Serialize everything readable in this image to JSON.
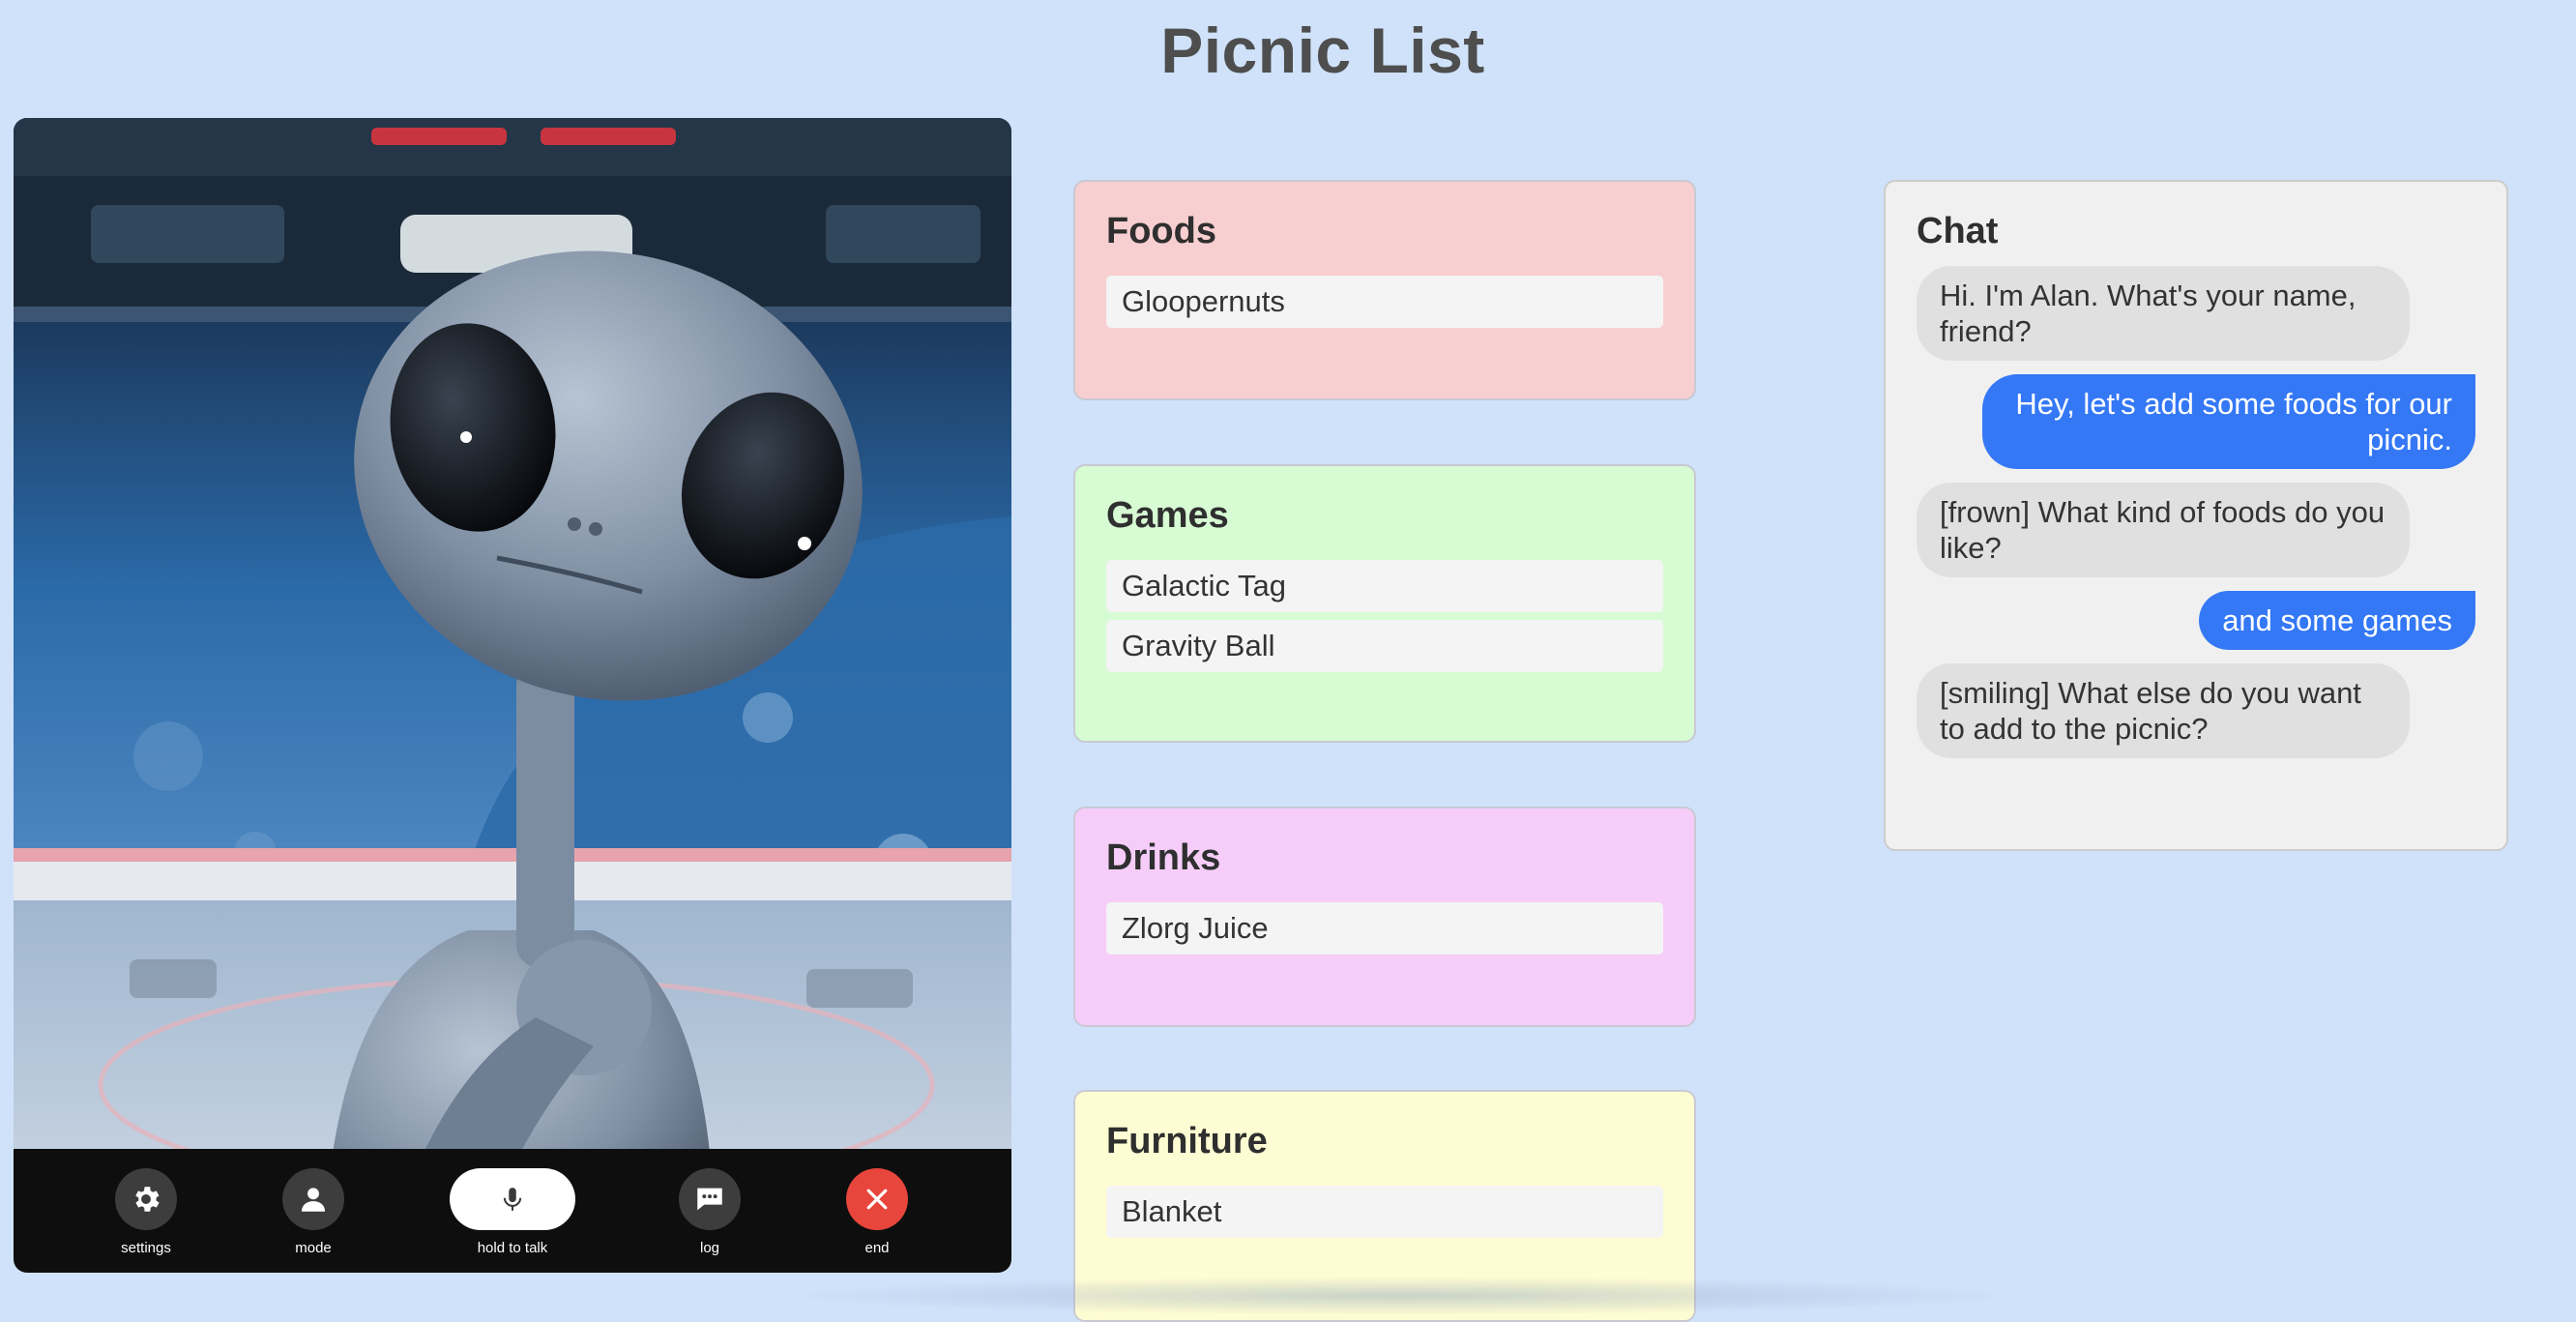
{
  "page": {
    "title": "Picnic List"
  },
  "controls": {
    "settings_label": "settings",
    "mode_label": "mode",
    "talk_label": "hold to talk",
    "log_label": "log",
    "end_label": "end"
  },
  "lists": {
    "foods": {
      "title": "Foods",
      "items": [
        "Gloopernuts"
      ]
    },
    "games": {
      "title": "Games",
      "items": [
        "Galactic Tag",
        "Gravity Ball"
      ]
    },
    "drinks": {
      "title": "Drinks",
      "items": [
        "Zlorg Juice"
      ]
    },
    "furniture": {
      "title": "Furniture",
      "items": [
        "Blanket"
      ]
    }
  },
  "chat": {
    "title": "Chat",
    "messages": [
      {
        "from": "bot",
        "text": "Hi. I'm Alan. What's your name, friend?"
      },
      {
        "from": "user",
        "text": "Hey, let's add some foods for our picnic."
      },
      {
        "from": "bot",
        "text": "[frown] What kind of foods do you like?"
      },
      {
        "from": "user",
        "text": "and some games"
      },
      {
        "from": "bot",
        "text": "[smiling] What else do you want to add to the picnic?"
      }
    ]
  },
  "colors": {
    "background": "#cfe2fa",
    "foods_card": "#f8cfd0",
    "games_card": "#d7fbd3",
    "drinks_card": "#f6cdf9",
    "furniture_card": "#fefcd2",
    "user_bubble": "#3478f6",
    "end_button": "#e8453c"
  },
  "icons": {
    "settings": "gear-icon",
    "mode": "person-icon",
    "talk": "microphone-icon",
    "log": "chat-bubble-icon",
    "end": "close-icon"
  }
}
